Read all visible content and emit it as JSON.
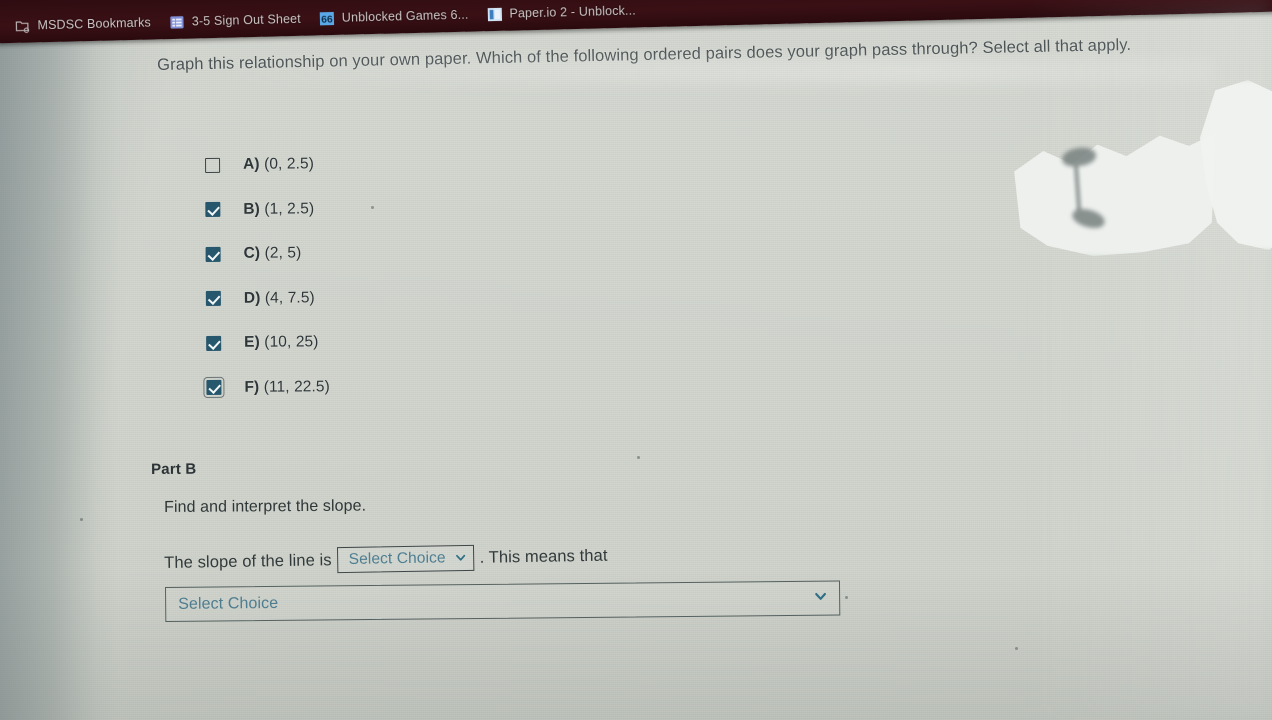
{
  "browser": {
    "bookmarks": [
      {
        "label": "MSDSC Bookmarks",
        "icon": "folder-icon"
      },
      {
        "label": "3-5 Sign Out Sheet",
        "icon": "list-icon"
      },
      {
        "label": "Unblocked Games 6...",
        "icon": "badge-66-icon",
        "badge_text": "66"
      },
      {
        "label": "Paper.io 2 - Unblock...",
        "icon": "app-tile-icon"
      }
    ]
  },
  "worksheet": {
    "question_stem": "Graph this relationship on your own paper.  Which of the following ordered pairs does your graph pass through? Select all that apply.",
    "choices": [
      {
        "letter": "A)",
        "pair": "(0, 2.5)",
        "checked": false,
        "focused": false
      },
      {
        "letter": "B)",
        "pair": "(1, 2.5)",
        "checked": true,
        "focused": false
      },
      {
        "letter": "C)",
        "pair": "(2, 5)",
        "checked": true,
        "focused": false
      },
      {
        "letter": "D)",
        "pair": "(4, 7.5)",
        "checked": true,
        "focused": false
      },
      {
        "letter": "E)",
        "pair": "(10, 25)",
        "checked": true,
        "focused": false
      },
      {
        "letter": "F)",
        "pair": "(11, 22.5)",
        "checked": true,
        "focused": true
      }
    ],
    "part_b": {
      "title": "Part B",
      "prompt": "Find and interpret the slope.",
      "sentence_before": "The slope of the line is",
      "slope_select_value": "Select Choice",
      "sentence_after": ". This means that",
      "meaning_select_value": "Select Choice"
    }
  },
  "colors": {
    "checkbox_fill": "#27576d",
    "select_text": "#4e7e91",
    "body_text": "#2e3639",
    "bookmark_bar": "#2d0c10",
    "page_bg": "#cfd3cb"
  }
}
